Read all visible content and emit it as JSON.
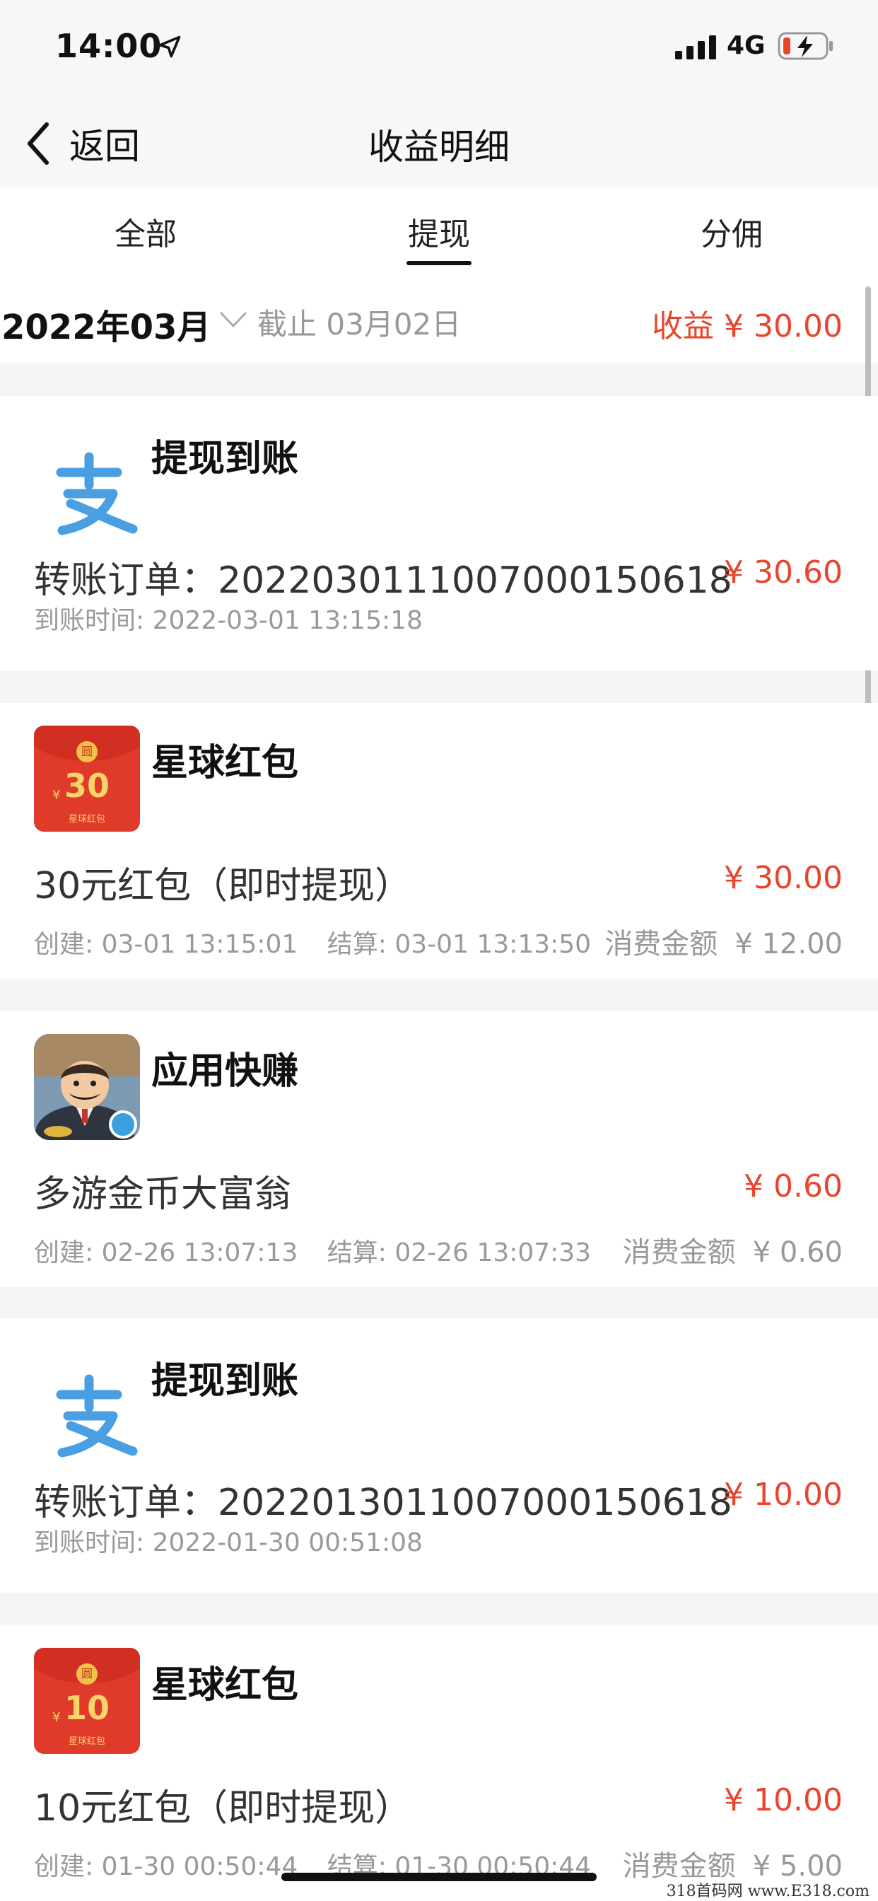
{
  "status_bar": {
    "time": "14:00",
    "network": "4G",
    "icons": [
      "location-arrow-icon",
      "signal-bars-icon",
      "battery-charging-icon"
    ]
  },
  "nav": {
    "back_label": "返回",
    "title": "收益明细"
  },
  "tabs": [
    {
      "label": "全部"
    },
    {
      "label": "提现",
      "selected": true
    },
    {
      "label": "分佣"
    }
  ],
  "summary": {
    "month": "2022年03月",
    "cutoff": "截止 03月02日",
    "income": "收益 ¥ 30.00"
  },
  "records": [
    {
      "icon": "alipay-icon",
      "title": "提现到账",
      "main": "转账订单：202203011100700015061800…",
      "amount": "¥ 30.60",
      "sub": "到账时间: 2022-03-01 13:15:18"
    },
    {
      "icon": "red-envelope-icon",
      "icon_value": "30",
      "icon_brand": "星球红包",
      "title": "星球红包",
      "main": "30元红包（即时提现）",
      "amount": "¥ 30.00",
      "created": "创建: 03-01 13:15:01",
      "settled": "结算: 03-01 13:13:50",
      "spend_label": "消费金额",
      "spend_value": "¥ 12.00"
    },
    {
      "icon": "game-character-icon",
      "title": "应用快赚",
      "main": "多游金币大富翁",
      "amount": "¥ 0.60",
      "created": "创建: 02-26 13:07:13",
      "settled": "结算: 02-26 13:07:33",
      "spend_label": "消费金额",
      "spend_value": "¥ 0.60"
    },
    {
      "icon": "alipay-icon",
      "title": "提现到账",
      "main": "转账订单：202201301100700015061800…",
      "amount": "¥ 10.00",
      "sub": "到账时间: 2022-01-30 00:51:08"
    },
    {
      "icon": "red-envelope-icon",
      "icon_value": "10",
      "icon_brand": "星球红包",
      "title": "星球红包",
      "main": "10元红包（即时提现）",
      "amount": "¥ 10.00",
      "created": "创建: 01-30 00:50:44",
      "settled": "结算: 01-30 00:50:44",
      "spend_label": "消费金额",
      "spend_value": "¥ 5.00"
    }
  ],
  "colors": {
    "accent_red": "#e8452c",
    "alipay_blue": "#4a9fe3",
    "envelope_red": "#e03a2b"
  },
  "watermark": "318首码网  www.E318.com"
}
